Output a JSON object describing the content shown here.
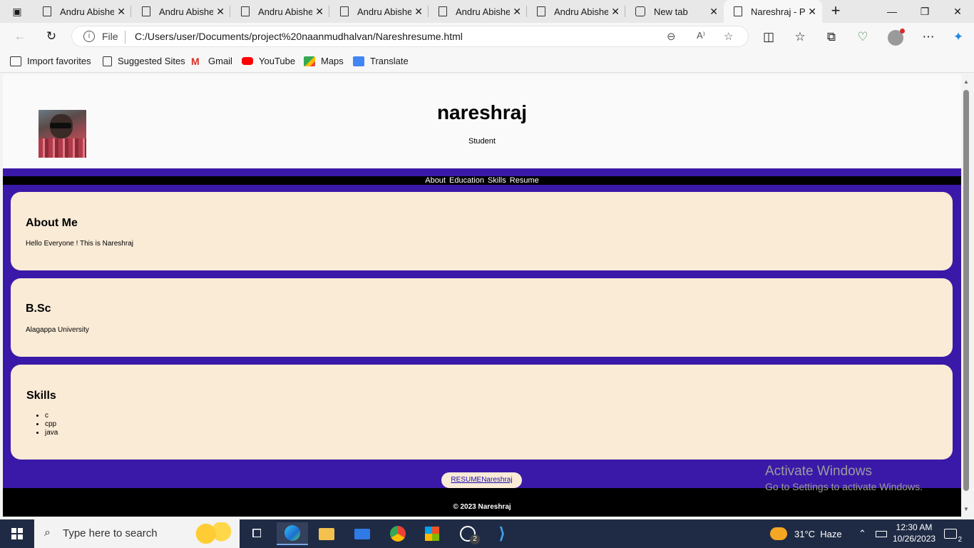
{
  "browser": {
    "tabs": [
      {
        "label": "Andru Abishek"
      },
      {
        "label": "Andru Abishek"
      },
      {
        "label": "Andru Abishek"
      },
      {
        "label": "Andru Abishek"
      },
      {
        "label": "Andru Abishek"
      },
      {
        "label": "Andru Abishek"
      },
      {
        "label": "New tab"
      },
      {
        "label": "Nareshraj - Po"
      }
    ],
    "address": {
      "scheme_label": "File",
      "url": "C:/Users/user/Documents/project%20naanmudhalvan/Nareshresume.html"
    },
    "favorites": [
      {
        "label": "Import favorites"
      },
      {
        "label": "Suggested Sites"
      },
      {
        "label": "Gmail"
      },
      {
        "label": "YouTube"
      },
      {
        "label": "Maps"
      },
      {
        "label": "Translate"
      }
    ]
  },
  "page": {
    "name": "nareshraj",
    "role": "Student",
    "nav": [
      "About",
      "Education",
      "Skills",
      "Resume"
    ],
    "about": {
      "heading": "About Me",
      "text": "Hello Everyone ! This is Nareshraj"
    },
    "education": {
      "heading": "B.Sc",
      "text": "Alagappa University"
    },
    "skills": {
      "heading": "Skills",
      "items": [
        "c",
        "cpp",
        "java"
      ]
    },
    "resume_link": "RESUMENareshraj",
    "footer": "© 2023 Nareshraj"
  },
  "watermark": {
    "line1": "Activate Windows",
    "line2": "Go to Settings to activate Windows."
  },
  "taskbar": {
    "search_placeholder": "Type here to search",
    "weather": "31°C  Haze",
    "time": "12:30 AM",
    "date": "10/26/2023",
    "notification_count": "2",
    "whatsapp_badge": "2"
  },
  "colors": {
    "page_body": "#3a19a8",
    "card": "#faebd7",
    "nav_bar": "#000000",
    "taskbar": "#1f2b45"
  }
}
